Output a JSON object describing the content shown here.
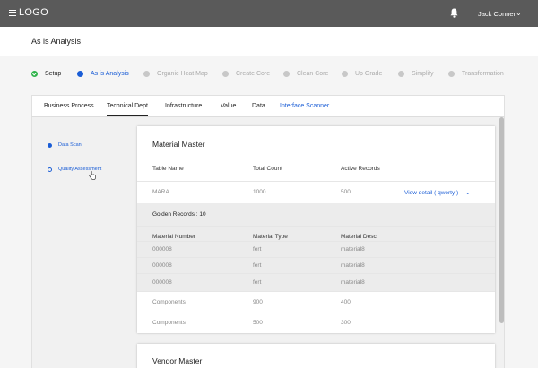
{
  "header": {
    "logo": "LOGO",
    "user_name": "Jack Conner",
    "user_caret": "⌄"
  },
  "page": {
    "title": "As is Analysis"
  },
  "steps": [
    {
      "label": "Setup",
      "state": "done"
    },
    {
      "label": "As is Analysis",
      "state": "active"
    },
    {
      "label": "Organic Heat Map",
      "state": "pending"
    },
    {
      "label": "Create Core",
      "state": "pending"
    },
    {
      "label": "Clean Core",
      "state": "pending"
    },
    {
      "label": "Up Grade",
      "state": "pending"
    },
    {
      "label": "Simplify",
      "state": "pending"
    },
    {
      "label": "Transformation",
      "state": "pending"
    }
  ],
  "tabs": [
    {
      "label": "Business Process"
    },
    {
      "label": "Technical Dept",
      "selected": true
    },
    {
      "label": "Infrastructure"
    },
    {
      "label": "Value"
    },
    {
      "label": "Data"
    },
    {
      "label": "Interface Scanner"
    }
  ],
  "sidebar": {
    "items": [
      {
        "label": "Data Scan"
      },
      {
        "label": "Quality Assessment"
      }
    ]
  },
  "material_master": {
    "title": "Material Master",
    "headers": [
      "Table Name",
      "Total Count",
      "Active Records"
    ],
    "row": {
      "table": "MARA",
      "total": "1000",
      "active": "500",
      "link": "View detail ( qwerty )",
      "link_caret": "⌄"
    },
    "golden_label": "Golden Records : 10",
    "golden_headers": [
      "Material Number",
      "Material Type",
      "Material Desc"
    ],
    "golden_rows": [
      [
        "000008",
        "fert",
        "material8"
      ],
      [
        "000008",
        "fert",
        "material8"
      ],
      [
        "000008",
        "fert",
        "material8"
      ]
    ],
    "other_rows": [
      [
        "Components",
        "900",
        "400"
      ],
      [
        "Components",
        "500",
        "300"
      ]
    ]
  },
  "vendor_master": {
    "title": "Vendor Master"
  },
  "colors": {
    "accent": "#1a5dd6",
    "success": "#2eb34a",
    "topbar": "#5a5a5a"
  }
}
